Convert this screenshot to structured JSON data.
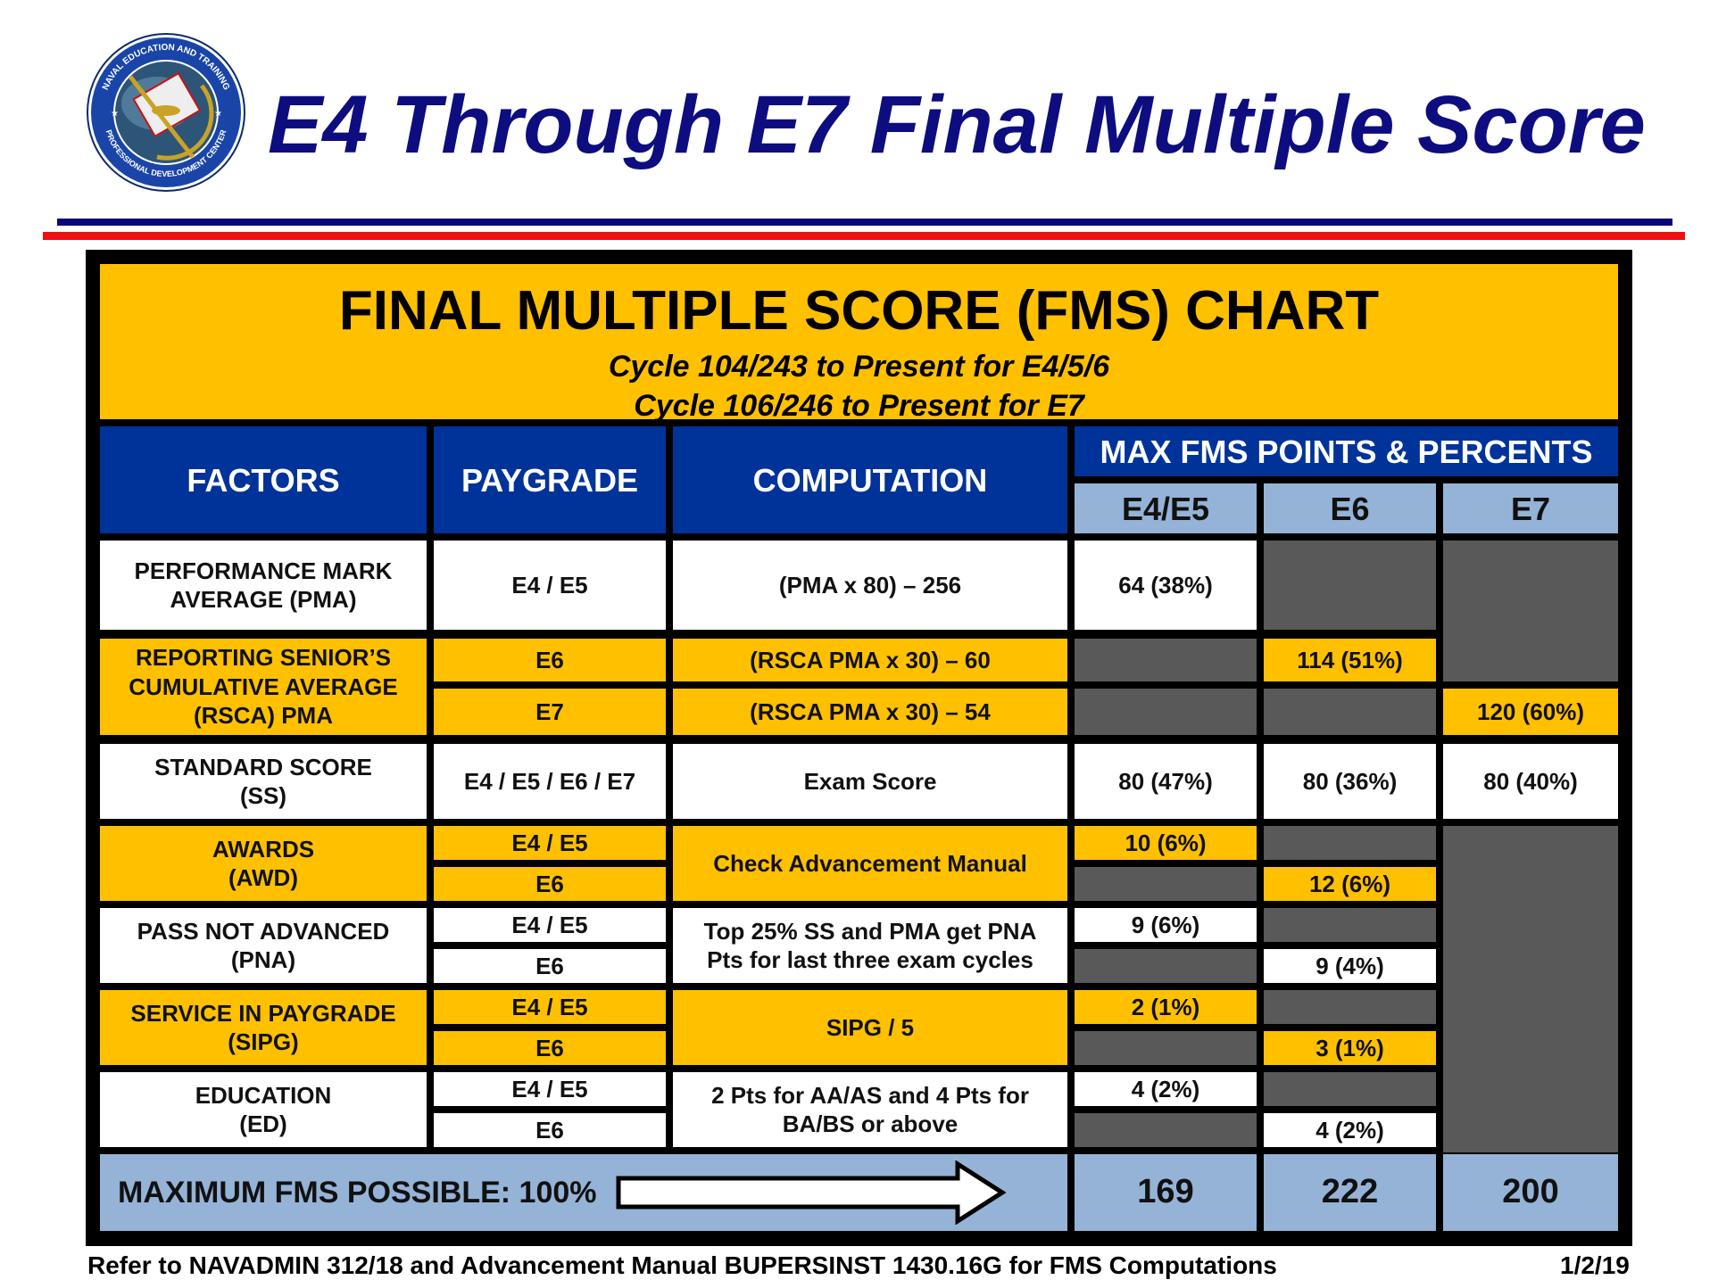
{
  "slide": {
    "title": "E4 Through E7 Final Multiple Score",
    "logo": {
      "icon": "naval-education-training-seal-icon",
      "top_text": "NAVAL EDUCATION AND TRAINING",
      "bottom_text": "PROFESSIONAL DEVELOPMENT CENTER"
    },
    "colors": {
      "title": "#0d0d80",
      "rule_blue": "#08087a",
      "rule_red": "#ee1111",
      "gold": "#ffc000",
      "navy": "#003399",
      "light_blue": "#95b3d7",
      "gray": "#595959"
    }
  },
  "chart": {
    "title": "FINAL MULTIPLE SCORE (FMS) CHART",
    "cycle_lines": [
      "Cycle 104/243 to Present for E4/5/6",
      "Cycle 106/246 to Present for E7"
    ],
    "headers": {
      "factors": "FACTORS",
      "paygrade": "PAYGRADE",
      "computation": "COMPUTATION",
      "max": "MAX FMS POINTS & PERCENTS",
      "cols": [
        "E4/E5",
        "E6",
        "E7"
      ]
    },
    "rows": {
      "pma": {
        "factor": "PERFORMANCE MARK AVERAGE (PMA)",
        "paygrade": "E4 / E5",
        "computation": "(PMA x 80) – 256",
        "e45": "64 (38%)"
      },
      "rsca": {
        "factor": "REPORTING SENIOR’S CUMULATIVE AVERAGE (RSCA) PMA",
        "e6": {
          "paygrade": "E6",
          "computation": "(RSCA PMA x 30) – 60",
          "value": "114 (51%)"
        },
        "e7": {
          "paygrade": "E7",
          "computation": "(RSCA PMA x 30) – 54",
          "value": "120 (60%)"
        }
      },
      "ss": {
        "factor": "STANDARD SCORE (SS)",
        "paygrade": "E4 / E5 / E6 / E7",
        "computation": "Exam Score",
        "e45": "80 (47%)",
        "e6": "80 (36%)",
        "e7": "80 (40%)"
      },
      "awd": {
        "factor": "AWARDS (AWD)",
        "pg_a": "E4 / E5",
        "pg_b": "E6",
        "computation": "Check Advancement Manual",
        "e45": "10 (6%)",
        "e6": "12 (6%)"
      },
      "pna": {
        "factor": "PASS NOT ADVANCED (PNA)",
        "pg_a": "E4 / E5",
        "pg_b": "E6",
        "computation": "Top 25% SS and PMA get PNA Pts for last three exam cycles",
        "e45": "9 (6%)",
        "e6": "9 (4%)"
      },
      "sipg": {
        "factor": "SERVICE IN PAYGRADE (SIPG)",
        "pg_a": "E4 / E5",
        "pg_b": "E6",
        "computation": "SIPG / 5",
        "e45": "2 (1%)",
        "e6": "3 (1%)"
      },
      "ed": {
        "factor": "EDUCATION (ED)",
        "pg_a": "E4 / E5",
        "pg_b": "E6",
        "computation": "2 Pts for AA/AS and 4 Pts for BA/BS or above",
        "e45": "4 (2%)",
        "e6": "4 (2%)"
      }
    },
    "total": {
      "label": "MAXIMUM FMS POSSIBLE:  100%",
      "arrow_icon": "right-arrow-icon",
      "e45": "169",
      "e6": "222",
      "e7": "200"
    }
  },
  "footer": {
    "reference": "Refer to NAVADMIN 312/18 and Advancement Manual BUPERSINST 1430.16G for FMS Computations",
    "date": "1/2/19"
  }
}
